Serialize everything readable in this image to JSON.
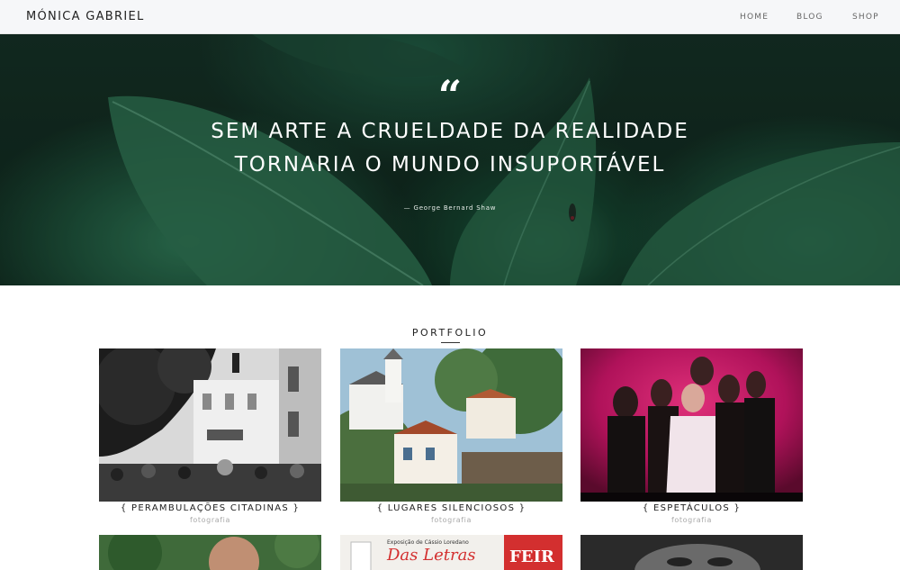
{
  "header": {
    "brand": "MÓNICA GABRIEL",
    "nav": [
      {
        "label": "HOME"
      },
      {
        "label": "BLOG"
      },
      {
        "label": "SHOP"
      }
    ]
  },
  "hero": {
    "quote_icon": "quote-open-icon",
    "quote_lines": [
      "SEM ARTE A CRUELDADE DA REALIDADE",
      "TORNARIA O MUNDO INSUPORTÁVEL"
    ],
    "author": "— George Bernard Shaw"
  },
  "portfolio": {
    "title": "PORTFOLIO",
    "items": [
      {
        "title": "{  PERAMBULAÇÕES CITADINAS  }",
        "category": "fotografia"
      },
      {
        "title": "{  LUGARES SILENCIOSOS  }",
        "category": "fotografia"
      },
      {
        "title": "{  ESPETÁCULOS  }",
        "category": "fotografia"
      }
    ],
    "next_row_poster_texts": [
      "Exposição de Cássio Loredano",
      "Das Letras",
      "FEIR"
    ]
  },
  "colors": {
    "accent_magenta": "#c2185b",
    "hero_green": "#1f5a42",
    "poster_red": "#d32f2f"
  }
}
